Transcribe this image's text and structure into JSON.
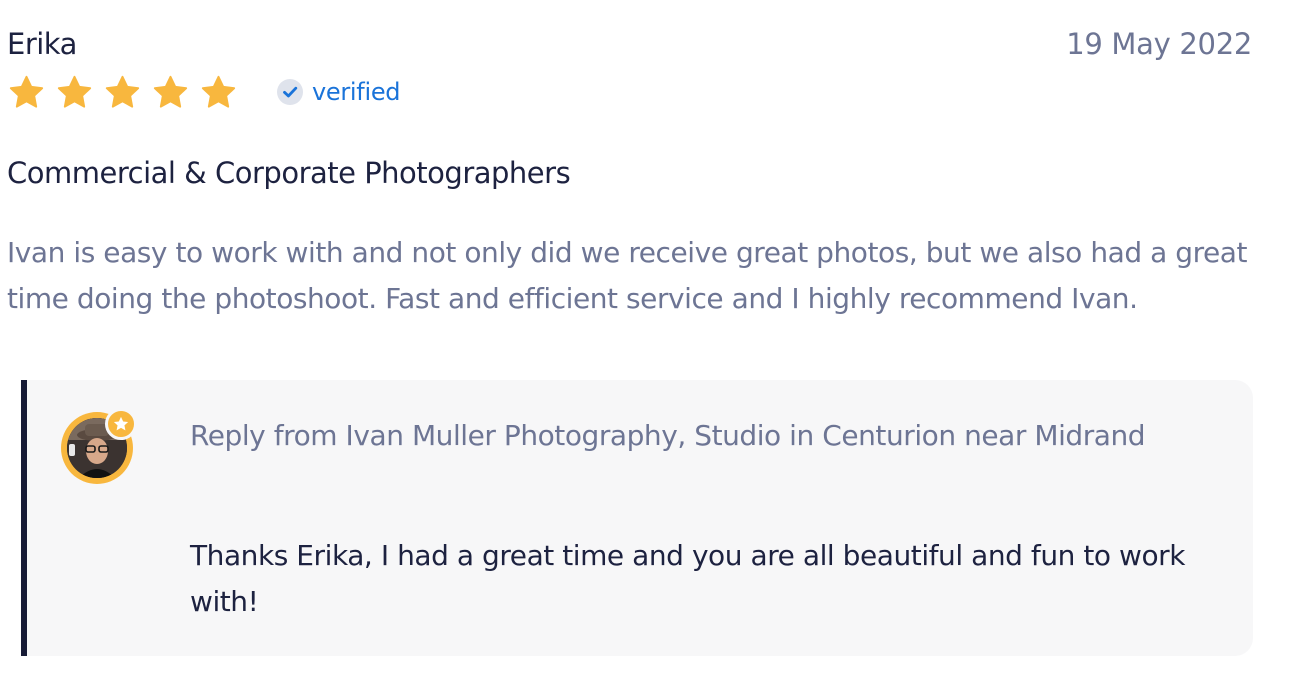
{
  "review": {
    "reviewer_name": "Erika",
    "date": "19 May 2022",
    "rating": 5,
    "rating_max": 5,
    "verified_label": "verified",
    "service_title": "Commercial & Corporate Photographers",
    "body": "Ivan is easy to work with and not only did we receive great photos, but we also had a great time doing the photoshoot. Fast and efficient service and I highly recommend Ivan.",
    "reply": {
      "heading": "Reply from Ivan Muller Photography, Studio in Centurion near Midrand",
      "text": "Thanks Erika, I had a great time and you are all beautiful and fun to work with!"
    }
  },
  "icons": {
    "star": "star-icon",
    "verified": "check-circle-icon",
    "avatar_badge": "star-badge-icon"
  },
  "colors": {
    "star": "#f8b73e",
    "verified": "#1a73d9",
    "heading_text": "#1d2240",
    "muted_text": "#6d7594",
    "reply_background": "#f7f7f8",
    "reply_border": "#171b36",
    "avatar_ring": "#f8b73e"
  }
}
